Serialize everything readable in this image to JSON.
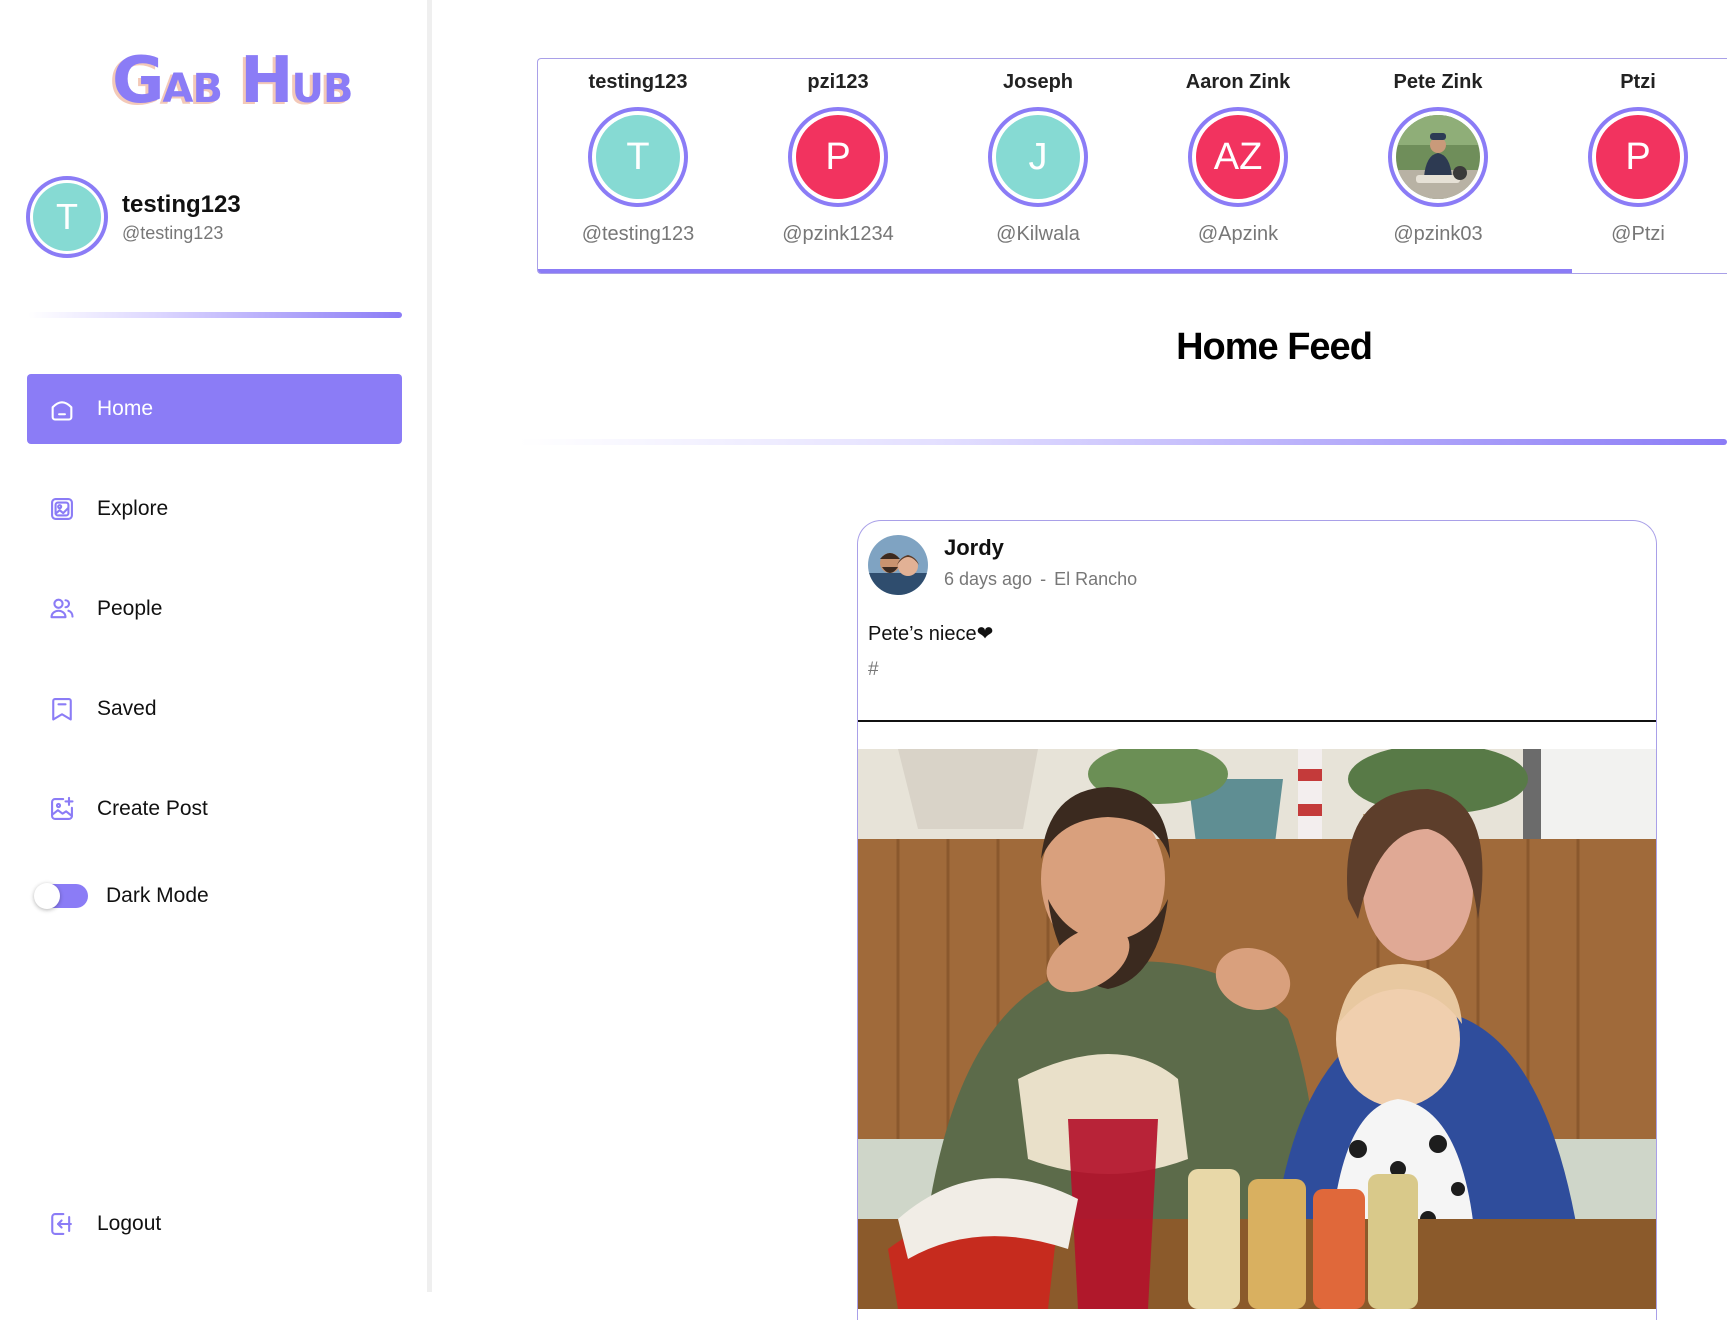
{
  "app": {
    "logo_first": "Gab",
    "logo_second": "Hub",
    "accent": "#8b7cf6"
  },
  "profile": {
    "initial": "T",
    "name": "testing123",
    "handle": "@testing123"
  },
  "nav": {
    "home": "Home",
    "explore": "Explore",
    "people": "People",
    "saved": "Saved",
    "create_post": "Create Post",
    "dark_mode": "Dark Mode",
    "logout": "Logout"
  },
  "stories": [
    {
      "name": "testing123",
      "initial": "T",
      "handle": "@testing123",
      "color": "#86dad3"
    },
    {
      "name": "pzi123",
      "initial": "P",
      "handle": "@pzink1234",
      "color": "#f2335f"
    },
    {
      "name": "Joseph",
      "initial": "J",
      "handle": "@Kilwala",
      "color": "#86dad3"
    },
    {
      "name": "Aaron Zink",
      "initial": "AZ",
      "handle": "@Apzink",
      "color": "#f2335f"
    },
    {
      "name": "Pete Zink",
      "initial": "",
      "handle": "@pzink03",
      "color": "#5b7a4a"
    },
    {
      "name": "Ptzi",
      "initial": "P",
      "handle": "@Ptzi",
      "color": "#f2335f"
    }
  ],
  "feed": {
    "title": "Home Feed"
  },
  "post": {
    "author": "Jordy",
    "time": "6 days ago",
    "separator": "-",
    "location": "El Rancho",
    "caption": "Pete’s niece❤",
    "tag": "#"
  }
}
